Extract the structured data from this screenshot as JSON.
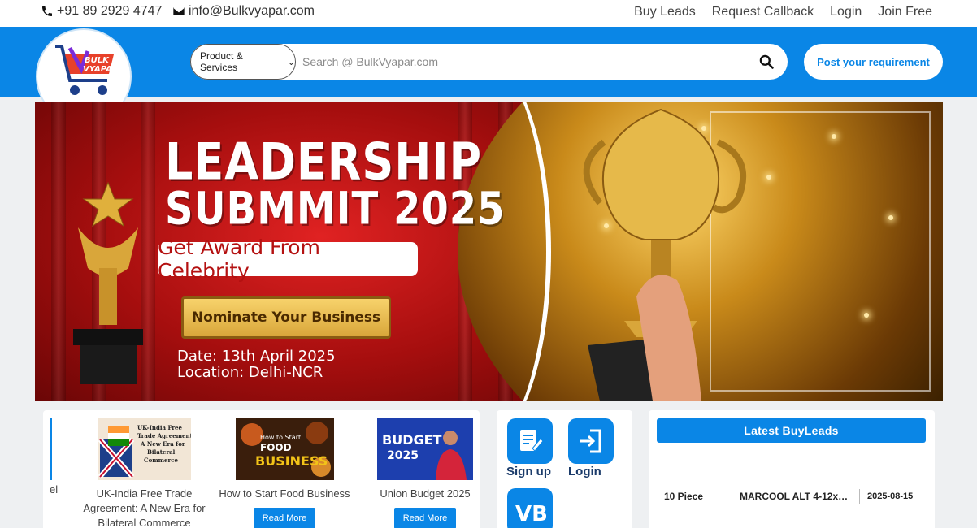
{
  "topbar": {
    "phone": "+91 89 2929 4747",
    "email": "info@Bulkvyapar.com",
    "links": [
      "Buy Leads",
      "Request Callback",
      "Login",
      "Join Free"
    ]
  },
  "header": {
    "logo_text": "BULK VYAPAR",
    "category_select": "Product & Services",
    "search_placeholder": "Search @ BulkVyapar.com",
    "post_requirement": "Post your requirement"
  },
  "banner": {
    "title_line1": "LEADERSHIP",
    "title_line2": "SUBMMIT 2025",
    "award": "Get Award From Celebrity",
    "nominate": "Nominate Your Business",
    "date": "Date: 13th April 2025",
    "location": "Location: Delhi-NCR"
  },
  "blogs": {
    "partial_title": "el",
    "items": [
      {
        "thumb_text": "UK-India Free Trade Agreement: A New Era for Bilateral Commerce",
        "title": "UK-India Free Trade Agreement: A New Era for Bilateral Commerce"
      },
      {
        "thumb_text": "How to Start FOOD BUSINESS",
        "title": "How to Start Food Business",
        "button": "Read More"
      },
      {
        "thumb_text": "BUDGET 2025",
        "title": "Union Budget 2025",
        "button": "Read More"
      }
    ]
  },
  "auth": {
    "signup": "Sign up",
    "login": "Login",
    "app_letters": "VB"
  },
  "buyleads": {
    "heading": "Latest BuyLeads",
    "rows": [
      {
        "qty": "10 Piece",
        "product": "MARCOOL ALT 4-12x…",
        "date": "2025-08-15"
      }
    ]
  },
  "colors": {
    "brand_blue": "#0a86e6",
    "banner_red": "#c01515",
    "gold": "#d9a63a"
  }
}
